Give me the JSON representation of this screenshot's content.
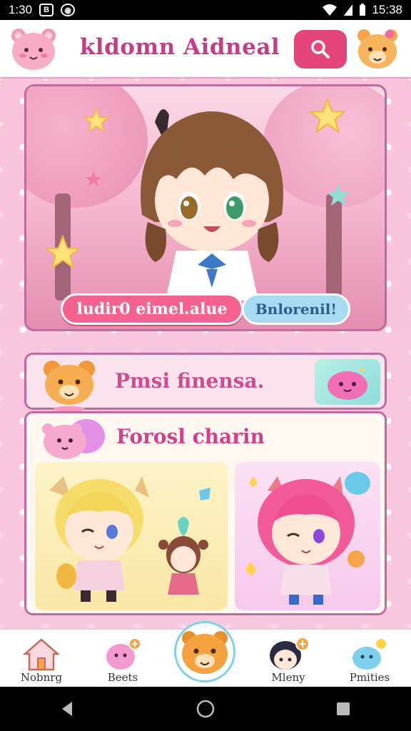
{
  "status_bar": {
    "time": "1:30",
    "battery": "15:38"
  },
  "header": {
    "title": "kldomn Aidneal"
  },
  "hero": {
    "primary_button": "ludir0 eimel.alue",
    "secondary_button": "Bnlorenil!"
  },
  "promo_banner": {
    "title": "Pmsi finensa."
  },
  "favorites": {
    "title": "Forosl charin"
  },
  "bottom_nav": {
    "items": [
      {
        "label": "Nobnrg",
        "icon": "house-icon"
      },
      {
        "label": "Beets",
        "icon": "pink-pet-icon"
      },
      {
        "label": "",
        "icon": "bear-mascot-icon"
      },
      {
        "label": "Mleny",
        "icon": "dark-hair-avatar-icon"
      },
      {
        "label": "Pmities",
        "icon": "blue-blob-icon"
      }
    ]
  },
  "colors": {
    "accent": "#e4457a",
    "title": "#c43d87",
    "frame": "#c06b9f",
    "background": "#f9c6dd"
  }
}
